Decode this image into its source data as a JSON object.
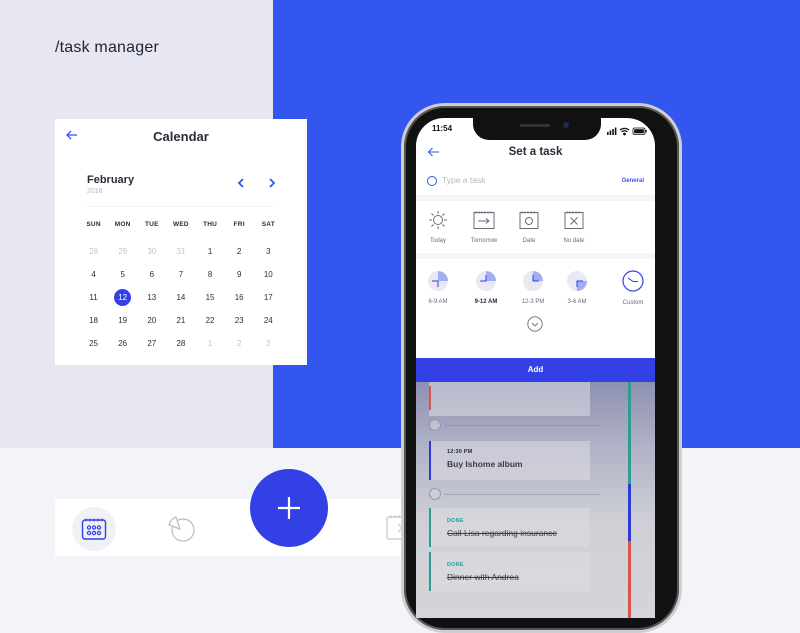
{
  "brand": "/task manager",
  "colors": {
    "accent": "#3340e6",
    "accent_bg": "#3356ee",
    "panel_bg": "#e6e7f1",
    "done_green": "#2f9c91",
    "red": "#d7564b"
  },
  "calendar": {
    "back_icon": "arrow-left-icon",
    "title": "Calendar",
    "month": "February",
    "year": "2018",
    "prev_icon": "chevron-left-icon",
    "next_icon": "chevron-right-icon",
    "weekdays": [
      "SUN",
      "MON",
      "TUE",
      "WED",
      "THU",
      "FRI",
      "SAT"
    ],
    "weeks": [
      [
        {
          "d": "28",
          "m": true
        },
        {
          "d": "29",
          "m": true
        },
        {
          "d": "30",
          "m": true
        },
        {
          "d": "31",
          "m": true
        },
        {
          "d": "1"
        },
        {
          "d": "2"
        },
        {
          "d": "3"
        }
      ],
      [
        {
          "d": "4"
        },
        {
          "d": "5"
        },
        {
          "d": "6"
        },
        {
          "d": "7"
        },
        {
          "d": "8"
        },
        {
          "d": "9"
        },
        {
          "d": "10"
        }
      ],
      [
        {
          "d": "11"
        },
        {
          "d": "12",
          "sel": true
        },
        {
          "d": "13"
        },
        {
          "d": "14"
        },
        {
          "d": "15"
        },
        {
          "d": "16"
        },
        {
          "d": "17"
        }
      ],
      [
        {
          "d": "18"
        },
        {
          "d": "19"
        },
        {
          "d": "20"
        },
        {
          "d": "21"
        },
        {
          "d": "22"
        },
        {
          "d": "23"
        },
        {
          "d": "24"
        }
      ],
      [
        {
          "d": "25"
        },
        {
          "d": "26"
        },
        {
          "d": "27"
        },
        {
          "d": "28"
        },
        {
          "d": "1",
          "m": true
        },
        {
          "d": "2",
          "m": true
        },
        {
          "d": "3",
          "m": true
        }
      ]
    ],
    "selected_day": "12"
  },
  "bottom_nav": {
    "items": [
      {
        "icon": "calendar-grid-icon",
        "active": true
      },
      {
        "icon": "pie-chart-icon",
        "active": false
      },
      {
        "icon": "calendar-next-icon",
        "active": false
      }
    ],
    "fab_icon": "plus-icon"
  },
  "phone": {
    "status": {
      "time": "11:54",
      "icons": [
        "signal-icon",
        "wifi-icon",
        "battery-icon"
      ]
    },
    "header": {
      "back_icon": "arrow-left-icon",
      "title": "Set a task"
    },
    "task_input": {
      "placeholder": "Type a task",
      "value": "",
      "category": "General"
    },
    "date_options": [
      {
        "label": "Today",
        "icon": "sun-icon"
      },
      {
        "label": "Tomorrow",
        "icon": "calendar-arrow-icon"
      },
      {
        "label": "Date",
        "icon": "calendar-date-icon"
      },
      {
        "label": "No date",
        "icon": "calendar-x-icon"
      }
    ],
    "time_options": [
      {
        "label": "6-9 AM",
        "icon": "clock-quarter-icon",
        "selected": false
      },
      {
        "label": "9-12 AM",
        "icon": "clock-quarter-icon",
        "selected": true
      },
      {
        "label": "12-3 PM",
        "icon": "clock-quarter-icon",
        "selected": false
      },
      {
        "label": "3-6 AM",
        "icon": "clock-quarter-icon",
        "selected": false
      },
      {
        "label": "Custom",
        "icon": "clock-icon",
        "selected": false
      }
    ],
    "expand_icon": "chevron-down-circle-icon",
    "add_label": "Add",
    "tasks": [
      {
        "time": "12:30 PM",
        "name": "Buy Ishome album",
        "status": "",
        "done": false
      },
      {
        "time": "",
        "name": "Call Lisa regarding insurance",
        "status": "DONE",
        "done": true
      },
      {
        "time": "",
        "name": "Dinner with Andrea",
        "status": "DONE",
        "done": true
      }
    ]
  }
}
